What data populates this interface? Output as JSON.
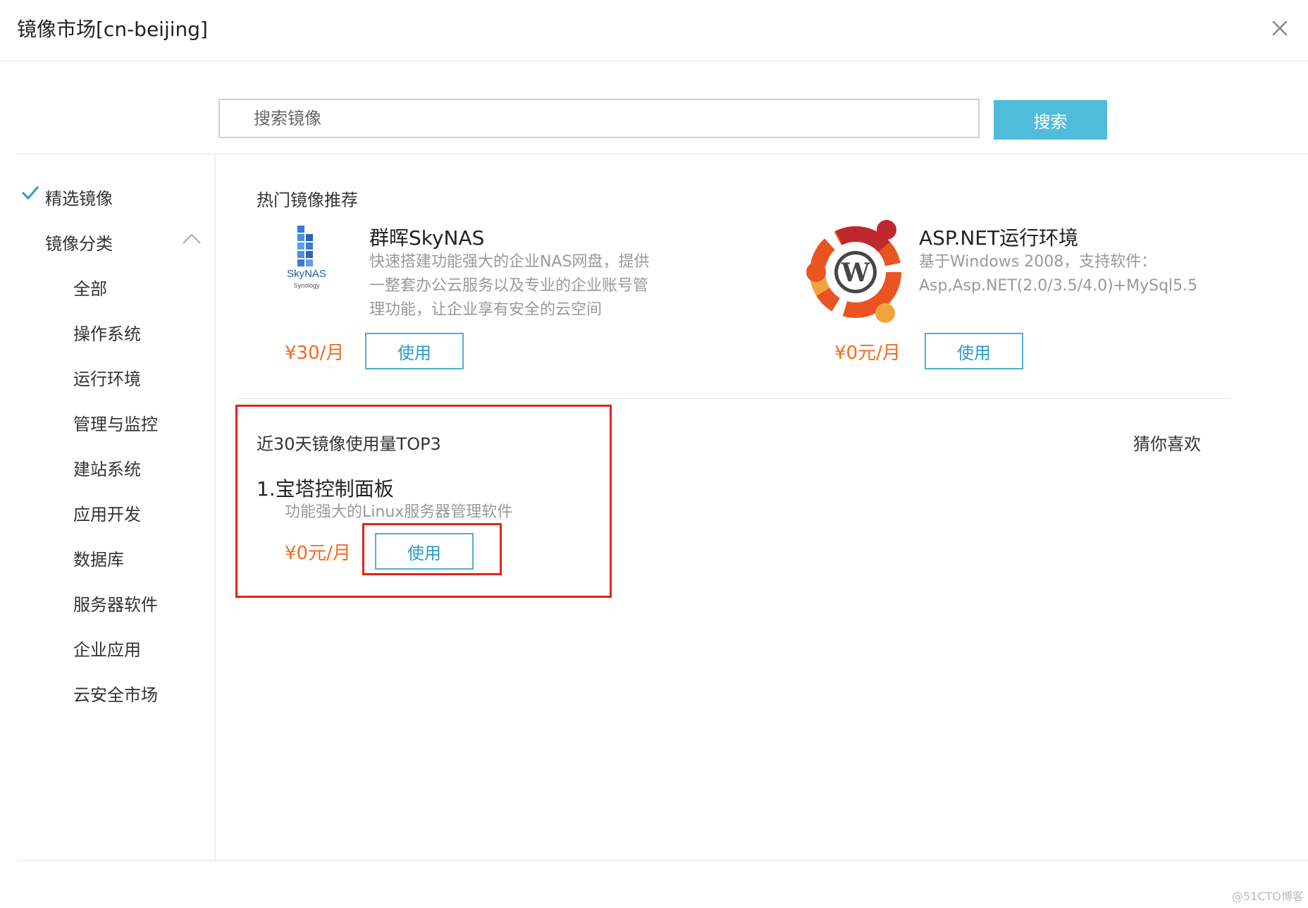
{
  "dialog": {
    "title": "镜像市场[cn-beijing]"
  },
  "search": {
    "placeholder": "搜索镜像",
    "button_label": "搜索"
  },
  "sidebar": {
    "selected_label": "精选镜像",
    "category_label": "镜像分类",
    "categories": [
      "全部",
      "操作系统",
      "运行环境",
      "管理与监控",
      "建站系统",
      "应用开发",
      "数据库",
      "服务器软件",
      "企业应用",
      "云安全市场"
    ]
  },
  "hot": {
    "title": "热门镜像推荐",
    "items": [
      {
        "logo_label": "SkyNAS",
        "logo_sub": "Synology",
        "title": "群晖SkyNAS",
        "desc_lines": [
          "快速搭建功能强大的企业NAS网盘，提供",
          "一整套办公云服务以及专业的企业账号管",
          "理功能，让企业享有安全的云空间"
        ],
        "price": "¥30/月",
        "button_label": "使用"
      },
      {
        "title": "ASP.NET运行环境",
        "desc_lines": [
          "基于Windows 2008，支持软件：",
          "Asp,Asp.NET(2.0/3.5/4.0)+MySql5.5"
        ],
        "price": "¥0元/月",
        "button_label": "使用"
      }
    ]
  },
  "top3": {
    "title": "近30天镜像使用量TOP3",
    "item": {
      "title": "1.宝塔控制面板",
      "desc": "功能强大的Linux服务器管理软件",
      "price": "¥0元/月",
      "button_label": "使用"
    }
  },
  "guess": {
    "title": "猜你喜欢"
  },
  "watermark": "@51CTO博客",
  "colors": {
    "accent": "#4fbcda",
    "price": "#f26b21",
    "highlight": "#e2231a",
    "check": "#2c9cc8"
  }
}
